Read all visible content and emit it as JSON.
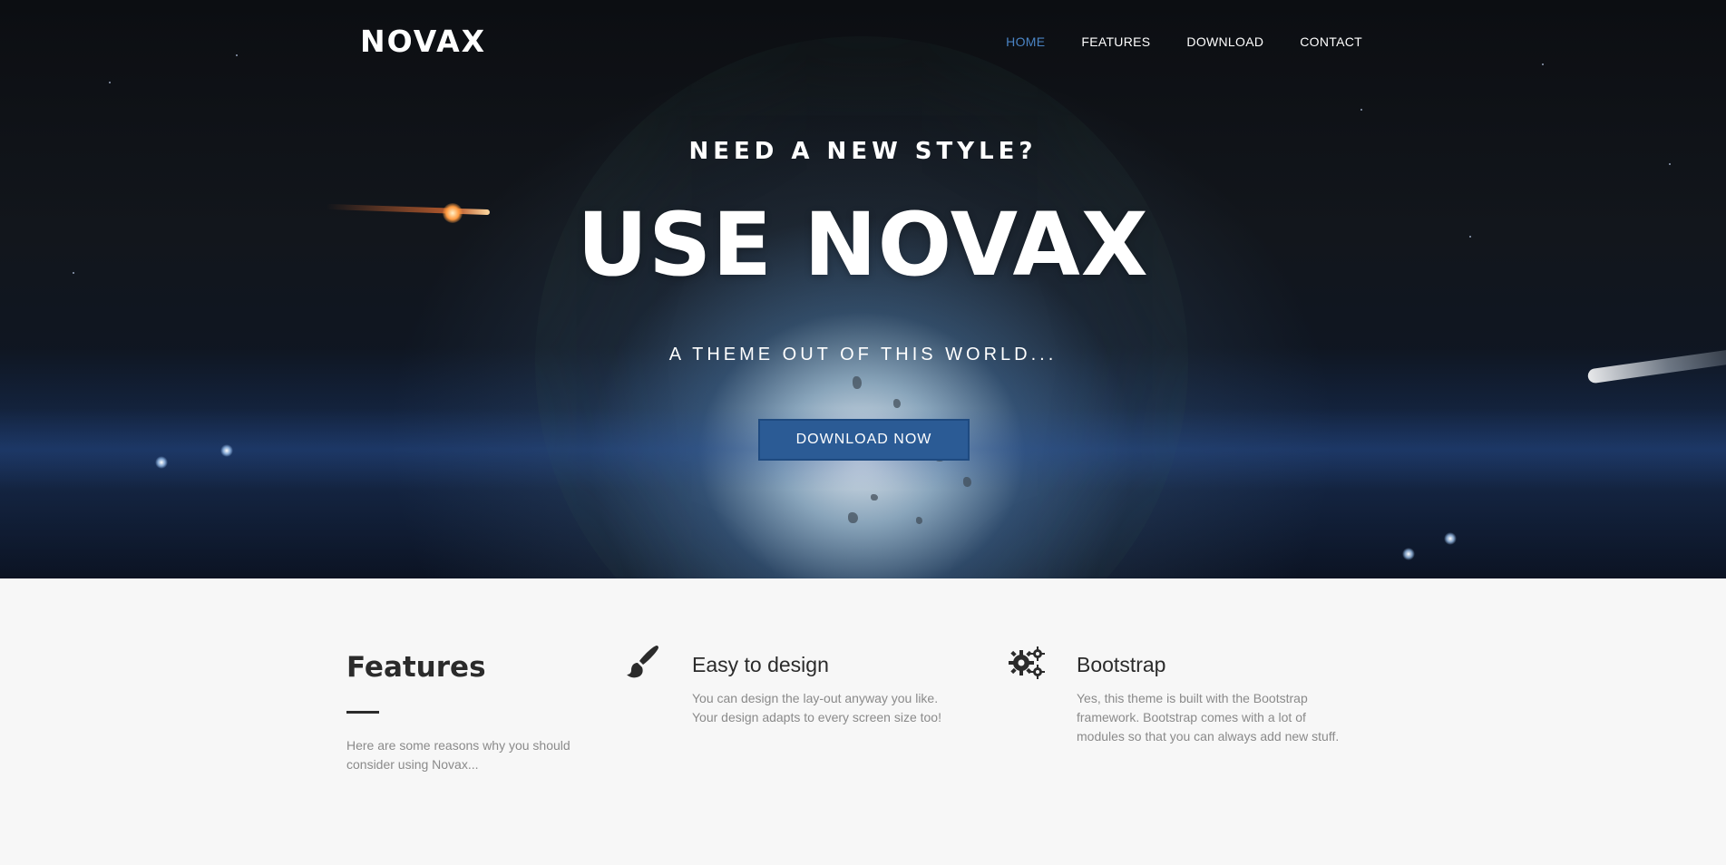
{
  "brand": {
    "logo": "NOVAX"
  },
  "nav": {
    "items": [
      {
        "label": "HOME",
        "active": true
      },
      {
        "label": "FEATURES",
        "active": false
      },
      {
        "label": "DOWNLOAD",
        "active": false
      },
      {
        "label": "CONTACT",
        "active": false
      }
    ],
    "active_color": "#4a84c4"
  },
  "hero": {
    "subtitle": "NEED A NEW STYLE?",
    "title": "USE NOVAX",
    "tagline": "A THEME OUT OF THIS WORLD...",
    "button_label": "DOWNLOAD NOW",
    "button_color": "#2b5b95"
  },
  "features": {
    "heading": "Features",
    "intro": "Here are some reasons why you should consider using Novax...",
    "items": [
      {
        "icon": "paintbrush-icon",
        "title": "Easy to design",
        "text": "You can design the lay-out anyway you like. Your design adapts to every screen size too!"
      },
      {
        "icon": "gears-icon",
        "title": "Bootstrap",
        "text": "Yes, this theme is built with the Bootstrap framework. Bootstrap comes with a lot of modules so that you can always add new stuff."
      }
    ]
  }
}
